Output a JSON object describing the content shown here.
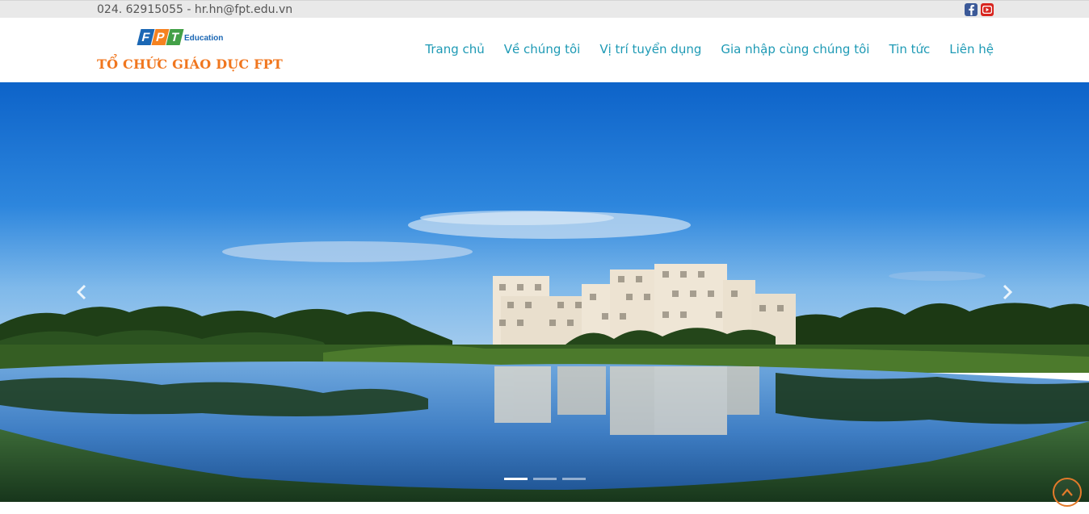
{
  "topbar": {
    "contact": "024. 62915055 - hr.hn@fpt.edu.vn",
    "social": [
      {
        "icon": "facebook-icon",
        "color": "#3b5998"
      },
      {
        "icon": "youtube-icon",
        "color": "#d8251f"
      }
    ]
  },
  "brand": {
    "logo_letters": [
      "F",
      "P",
      "T"
    ],
    "logo_sub": "Education",
    "org_name": "TỔ CHỨC GIÁO DỤC FPT",
    "colors": {
      "blue": "#1b67b4",
      "orange": "#f58220",
      "green": "#43a047"
    }
  },
  "nav": {
    "items": [
      {
        "label": "Trang chủ"
      },
      {
        "label": "Về chúng tôi"
      },
      {
        "label": "Vị trí tuyển dụng"
      },
      {
        "label": "Gia nhập cùng chúng tôi"
      },
      {
        "label": "Tin tức"
      },
      {
        "label": "Liên hệ"
      }
    ],
    "color": "#1e9ab5"
  },
  "carousel": {
    "slide_count": 3,
    "active_index": 0,
    "prev_icon": "chevron-left-icon",
    "next_icon": "chevron-right-icon"
  },
  "scroll_top": {
    "icon": "chevron-up-icon",
    "color": "#e37a2a"
  }
}
